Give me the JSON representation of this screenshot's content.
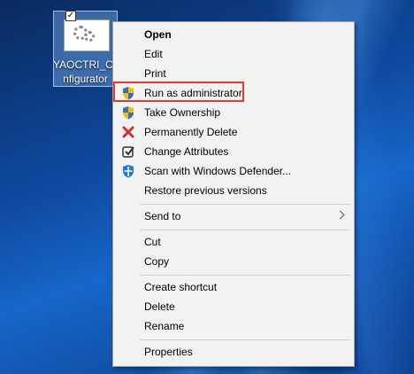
{
  "desktop": {
    "icon_label": "YAOCTRI_Co\nnfigurator",
    "checkbox_mark": "✓"
  },
  "context_menu": {
    "items": [
      {
        "label": "Open",
        "bold": true
      },
      {
        "label": "Edit"
      },
      {
        "label": "Print"
      },
      {
        "label": "Run as administrator",
        "icon": "uac-shield-icon",
        "highlighted": true
      },
      {
        "label": "Take Ownership",
        "icon": "uac-shield-icon"
      },
      {
        "label": "Permanently Delete",
        "icon": "red-x-icon"
      },
      {
        "label": "Change Attributes",
        "icon": "checklist-icon"
      },
      {
        "label": "Scan with Windows Defender...",
        "icon": "windows-defender-icon"
      },
      {
        "label": "Restore previous versions"
      },
      {
        "label": "Send to",
        "submenu": true
      },
      {
        "label": "Cut"
      },
      {
        "label": "Copy"
      },
      {
        "label": "Create shortcut"
      },
      {
        "label": "Delete"
      },
      {
        "label": "Rename"
      },
      {
        "label": "Properties"
      }
    ]
  },
  "colors": {
    "highlight_border": "#e53935",
    "menu_background": "#f2f2f2"
  }
}
